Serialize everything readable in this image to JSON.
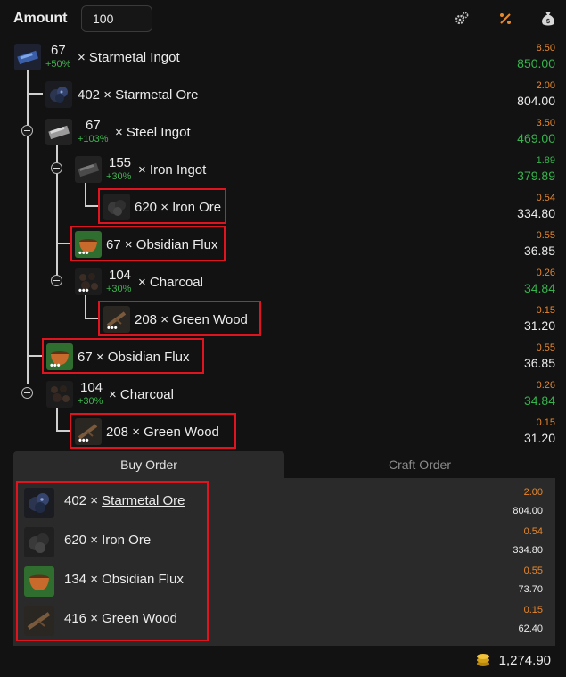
{
  "header": {
    "amount_label": "Amount",
    "amount_value": "100",
    "icons": [
      "gears-icon",
      "percent-icon",
      "money-bag-icon"
    ]
  },
  "tree": {
    "rows": [
      {
        "qty": "67",
        "bonus": "+50%",
        "name": "× Starmetal Ingot",
        "unit": "8.50",
        "total": "850.00",
        "unit_color": "orange",
        "total_color": "green",
        "icon": "starmetal-ingot-icon"
      },
      {
        "qty": "402",
        "name": "402 × Starmetal Ore",
        "unit": "2.00",
        "total": "804.00",
        "unit_color": "orange",
        "total_color": "white",
        "icon": "starmetal-ore-icon"
      },
      {
        "qty": "67",
        "bonus": "+103%",
        "name": "× Steel Ingot",
        "unit": "3.50",
        "total": "469.00",
        "unit_color": "orange",
        "total_color": "green",
        "icon": "steel-ingot-icon"
      },
      {
        "qty": "155",
        "bonus": "+30%",
        "name": "× Iron Ingot",
        "unit": "1.89",
        "total": "379.89",
        "unit_color": "green",
        "total_color": "green",
        "icon": "iron-ingot-icon"
      },
      {
        "name": "620 × Iron Ore",
        "unit": "0.54",
        "total": "334.80",
        "unit_color": "orange",
        "total_color": "white",
        "icon": "iron-ore-icon"
      },
      {
        "name": "67 × Obsidian Flux",
        "unit": "0.55",
        "total": "36.85",
        "unit_color": "orange",
        "total_color": "white",
        "icon": "obsidian-flux-icon"
      },
      {
        "qty": "104",
        "bonus": "+30%",
        "name": "× Charcoal",
        "unit": "0.26",
        "total": "34.84",
        "unit_color": "orange",
        "total_color": "green",
        "icon": "charcoal-icon"
      },
      {
        "name": "208 × Green Wood",
        "unit": "0.15",
        "total": "31.20",
        "unit_color": "orange",
        "total_color": "white",
        "icon": "green-wood-icon"
      },
      {
        "name": "67 × Obsidian Flux",
        "unit": "0.55",
        "total": "36.85",
        "unit_color": "orange",
        "total_color": "white",
        "icon": "obsidian-flux-icon"
      },
      {
        "qty": "104",
        "bonus": "+30%",
        "name": "× Charcoal",
        "unit": "0.26",
        "total": "34.84",
        "unit_color": "orange",
        "total_color": "green",
        "icon": "charcoal-icon"
      },
      {
        "name": "208 × Green Wood",
        "unit": "0.15",
        "total": "31.20",
        "unit_color": "orange",
        "total_color": "white",
        "icon": "green-wood-icon"
      }
    ]
  },
  "tabs": {
    "buy": "Buy Order",
    "craft": "Craft Order"
  },
  "buy_order": {
    "items": [
      {
        "qty": "402 ×",
        "name": "Starmetal Ore",
        "unit": "2.00",
        "total": "804.00",
        "icon": "starmetal-ore-icon"
      },
      {
        "qty": "620 ×",
        "name": "Iron Ore",
        "unit": "0.54",
        "total": "334.80",
        "icon": "iron-ore-icon"
      },
      {
        "qty": "134 ×",
        "name": "Obsidian Flux",
        "unit": "0.55",
        "total": "73.70",
        "icon": "obsidian-flux-icon"
      },
      {
        "qty": "416 ×",
        "name": "Green Wood",
        "unit": "0.15",
        "total": "62.40",
        "icon": "green-wood-icon"
      }
    ],
    "grand_total": "1,274.90"
  },
  "colors": {
    "orange": "#e8862c",
    "green": "#37b24d",
    "highlight": "#e0141e",
    "background": "#121212",
    "panel": "#2a2a2a"
  }
}
